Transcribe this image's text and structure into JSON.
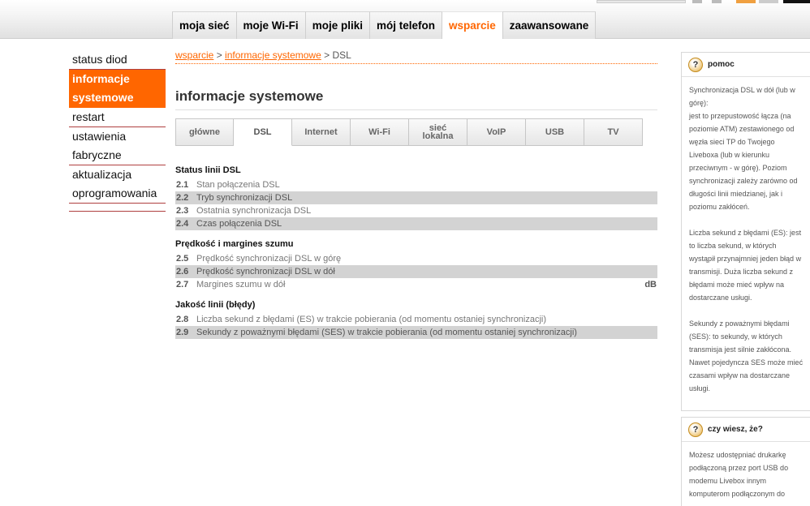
{
  "colors": {
    "accent": "#ff6600",
    "shade": "#d3d3d3"
  },
  "main_nav": [
    {
      "label": "moja sieć",
      "active": false
    },
    {
      "label": "moje Wi-Fi",
      "active": false
    },
    {
      "label": "moje pliki",
      "active": false
    },
    {
      "label": "mój telefon",
      "active": false
    },
    {
      "label": "wsparcie",
      "active": true
    },
    {
      "label": "zaawansowane",
      "active": false
    }
  ],
  "sidebar": [
    {
      "lines": [
        "status diod"
      ],
      "active": false
    },
    {
      "lines": [
        "informacje",
        "systemowe"
      ],
      "active": true
    },
    {
      "lines": [
        "restart"
      ],
      "active": false
    },
    {
      "lines": [
        "ustawienia",
        "fabryczne"
      ],
      "active": false
    },
    {
      "lines": [
        "aktualizacja",
        "oprogramowania"
      ],
      "active": false
    }
  ],
  "breadcrumb": {
    "link1": "wsparcie",
    "sep": " > ",
    "link2": "informacje systemowe",
    "current": "DSL"
  },
  "page_title": "informacje systemowe",
  "subtabs": [
    {
      "lines": [
        "główne"
      ],
      "active": false
    },
    {
      "lines": [
        "DSL"
      ],
      "active": true
    },
    {
      "lines": [
        "Internet"
      ],
      "active": false
    },
    {
      "lines": [
        "Wi-Fi"
      ],
      "active": false
    },
    {
      "lines": [
        "sieć",
        "lokalna"
      ],
      "active": false
    },
    {
      "lines": [
        "VoIP"
      ],
      "active": false
    },
    {
      "lines": [
        "USB"
      ],
      "active": false
    },
    {
      "lines": [
        "TV"
      ],
      "active": false
    }
  ],
  "sections": [
    {
      "title": "Status linii DSL",
      "rows": [
        {
          "num": "2.1",
          "label": "Stan połączenia DSL",
          "unit": "",
          "shade": false
        },
        {
          "num": "2.2",
          "label": "Tryb synchronizacji DSL",
          "unit": "",
          "shade": true
        },
        {
          "num": "2.3",
          "label": "Ostatnia synchronizacja DSL",
          "unit": "",
          "shade": false
        },
        {
          "num": "2.4",
          "label": "Czas połączenia DSL",
          "unit": "",
          "shade": true
        }
      ]
    },
    {
      "title": "Prędkość i margines szumu",
      "rows": [
        {
          "num": "2.5",
          "label": "Prędkość synchronizacji DSL w górę",
          "unit": "",
          "shade": false
        },
        {
          "num": "2.6",
          "label": "Prędkość synchronizacji DSL w dół",
          "unit": "",
          "shade": true
        },
        {
          "num": "2.7",
          "label": "Margines szumu w dół",
          "unit": "dB",
          "shade": false
        }
      ]
    },
    {
      "title": "Jakość linii (błędy)",
      "rows": [
        {
          "num": "2.8",
          "label": "Liczba sekund z błędami (ES) w trakcie pobierania (od momentu ostaniej synchronizacji)",
          "unit": "",
          "shade": false
        },
        {
          "num": "2.9",
          "label": "Sekundy z poważnymi błędami (SES) w trakcie pobierania (od momentu ostaniej synchronizacji)",
          "unit": "",
          "shade": true
        }
      ]
    }
  ],
  "help": {
    "title": "pomoc",
    "paragraphs": [
      [
        "Synchronizacja DSL w dół (lub w",
        "górę):",
        "jest to przepustowość łącza (na",
        "poziomie ATM) zestawionego od",
        "węzła sieci TP do Twojego",
        "Liveboxa (lub w kierunku",
        "przeciwnym - w górę). Poziom",
        "synchronizacji zależy zarówno od",
        "długości linii miedzianej, jak i",
        "poziomu zakłóceń."
      ],
      [
        "Liczba sekund z błędami (ES): jest",
        "to liczba sekund, w których",
        "wystąpił przynajmniej jeden błąd w",
        "transmisji. Duża liczba sekund z",
        "błędami może mieć wpływ na",
        "dostarczane usługi."
      ],
      [
        "Sekundy z poważnymi błędami",
        "(SES): to sekundy, w których",
        "transmisja jest silnie zakłócona.",
        "Nawet pojedyncza SES może mieć",
        "czasami wpływ na dostarczane",
        "usługi."
      ]
    ]
  },
  "tip": {
    "title": "czy wiesz, że?",
    "lines": [
      "Możesz udostępniać drukarkę",
      "podłączoną przez port USB do",
      "modemu Livebox innym",
      "komputerom podłączonym do"
    ]
  },
  "icons": {
    "help": "question-icon",
    "tip": "question-icon",
    "help_glyph": "?"
  }
}
